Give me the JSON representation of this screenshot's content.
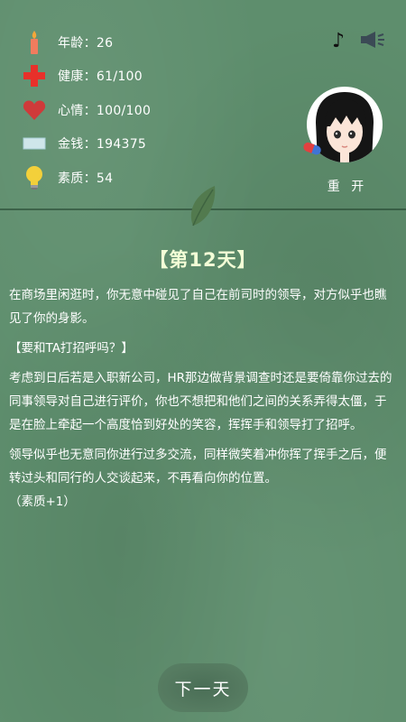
{
  "stats": {
    "age": "年龄：26",
    "health": "健康：61/100",
    "mood": "心情：100/100",
    "money": "金钱：194375",
    "quality": "素质：54"
  },
  "toolbar": {
    "music_icon": "music-note-icon",
    "sound_icon": "speaker-icon"
  },
  "profile": {
    "restart_label": "重 开"
  },
  "event": {
    "day_title": "【第12天】",
    "paragraph_1": "在商场里闲逛时，你无意中碰见了自己在前司时的领导，对方似乎也瞧见了你的身影。",
    "question": "【要和TA打招呼吗？】",
    "paragraph_2": "考虑到日后若是入职新公司，HR那边做背景调查时还是要倚靠你过去的同事领导对自己进行评价，你也不想把和他们之间的关系弄得太僵，于是在脸上牵起一个高度恰到好处的笑容，挥挥手和领导打了招呼。",
    "paragraph_3": "领导似乎也无意同你进行过多交流，同样微笑着冲你挥了挥手之后，便转过头和同行的人交谈起来，不再看向你的位置。",
    "effect": "（素质+1）"
  },
  "footer": {
    "next_label": "下一天"
  }
}
